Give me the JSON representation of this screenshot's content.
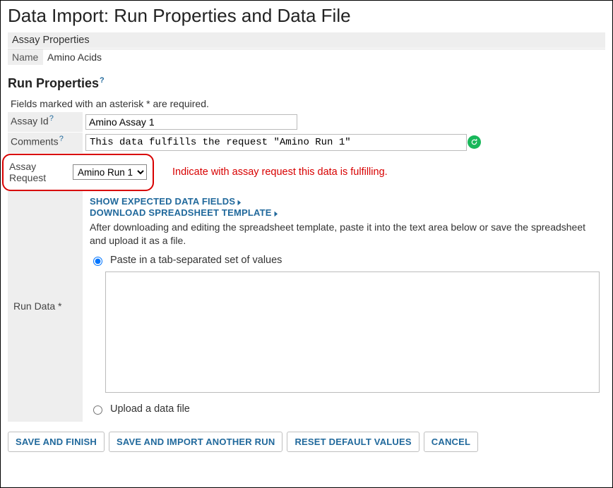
{
  "page_title": "Data Import: Run Properties and Data File",
  "assay_properties": {
    "header": "Assay Properties",
    "name_label": "Name",
    "name_value": "Amino Acids"
  },
  "run_properties": {
    "header": "Run Properties",
    "required_note": "Fields marked with an asterisk * are required.",
    "assay_id": {
      "label": "Assay Id",
      "value": "Amino Assay 1"
    },
    "comments": {
      "label": "Comments",
      "value": "This data fulfills the request \"Amino Run 1\""
    },
    "assay_request": {
      "label": "Assay Request",
      "selected": "Amino Run 1",
      "annotation": "Indicate with assay request this data is fulfilling."
    }
  },
  "run_data": {
    "label": "Run Data *",
    "links": {
      "show_fields": "SHOW EXPECTED DATA FIELDS",
      "download_template": "DOWNLOAD SPREADSHEET TEMPLATE"
    },
    "instructions": "After downloading and editing the spreadsheet template, paste it into the text area below or save the spreadsheet and upload it as a file.",
    "paste_option": "Paste in a tab-separated set of values",
    "upload_option": "Upload a data file"
  },
  "buttons": {
    "save_finish": "SAVE AND FINISH",
    "save_import": "SAVE AND IMPORT ANOTHER RUN",
    "reset": "RESET DEFAULT VALUES",
    "cancel": "CANCEL"
  },
  "help_glyph": "?"
}
